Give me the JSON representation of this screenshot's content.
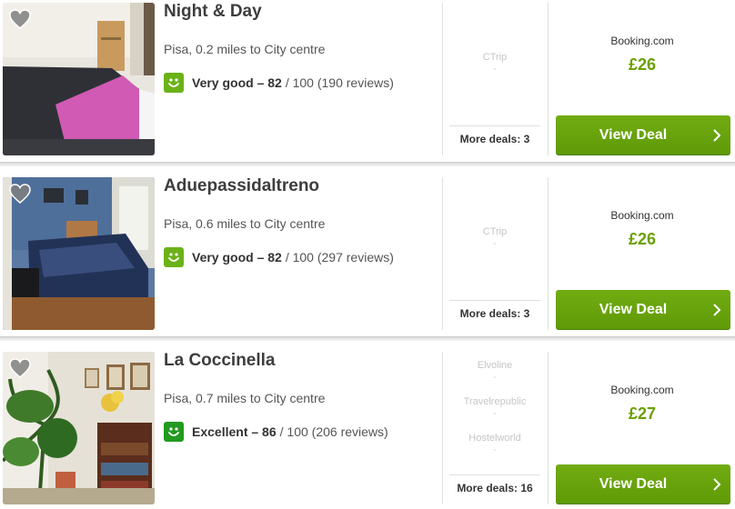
{
  "listings": [
    {
      "name": "Night & Day",
      "location": "Pisa, 0.2 miles to City centre",
      "rating_label": "Very good – 82",
      "rating_rest": "/ 100 (190 reviews)",
      "rating_color": "#6bb219",
      "other_providers": [
        "CTrip"
      ],
      "more_deals": "More deals: 3",
      "provider": "Booking.com",
      "price": "£26",
      "deal_label": "View Deal"
    },
    {
      "name": "Aduepassidaltreno",
      "location": "Pisa, 0.6 miles to City centre",
      "rating_label": "Very good – 82",
      "rating_rest": "/ 100 (297 reviews)",
      "rating_color": "#6bb219",
      "other_providers": [
        "CTrip"
      ],
      "more_deals": "More deals: 3",
      "provider": "Booking.com",
      "price": "£26",
      "deal_label": "View Deal"
    },
    {
      "name": "La Coccinella",
      "location": "Pisa, 0.7 miles to City centre",
      "rating_label": "Excellent – 86",
      "rating_rest": "/ 100 (206 reviews)",
      "rating_color": "#229a1f",
      "other_providers": [
        "Elvoline",
        "Travelrepublic",
        "Hostelworld"
      ],
      "more_deals": "More deals: 16",
      "provider": "Booking.com",
      "price": "£27",
      "deal_label": "View Deal"
    }
  ],
  "other_price_placeholder": "-",
  "icons": {
    "favorite": "heart-icon",
    "rating": "smiley-icon",
    "deal_arrow": "chevron-right-icon"
  }
}
